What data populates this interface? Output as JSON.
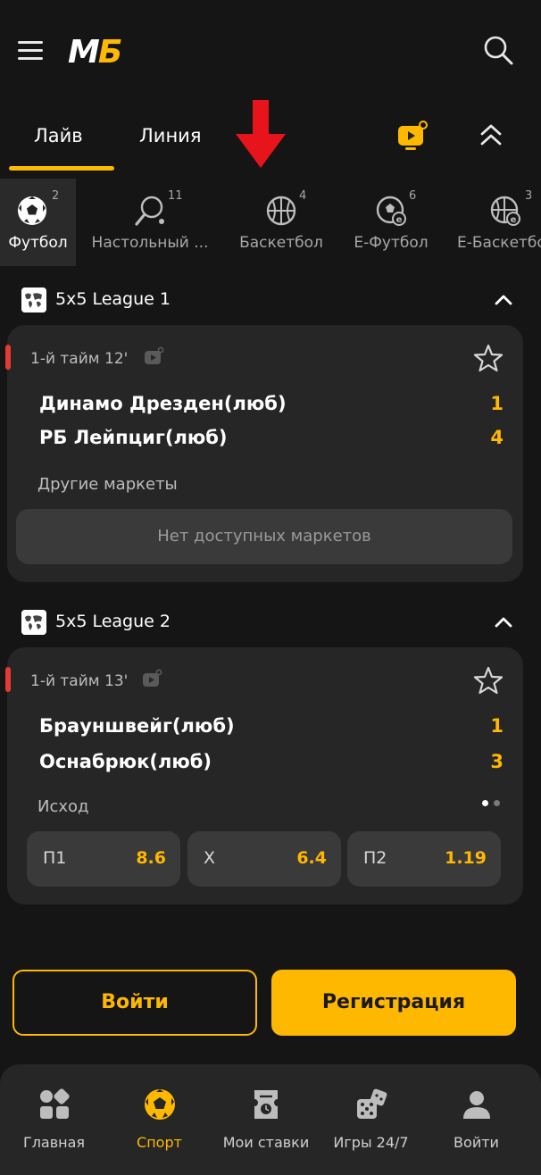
{
  "header": {
    "logo_m": "M",
    "logo_b": "Б"
  },
  "tabs": {
    "live": "Лайв",
    "line": "Линия"
  },
  "sports": [
    {
      "label": "Футбол",
      "count": "2",
      "icon": "soccer-ball-icon"
    },
    {
      "label": "Настольный ...",
      "count": "11",
      "icon": "table-tennis-icon"
    },
    {
      "label": "Баскетбол",
      "count": "4",
      "icon": "basketball-icon"
    },
    {
      "label": "E-Футбол",
      "count": "6",
      "icon": "esoccer-icon"
    },
    {
      "label": "E-Баскетбол",
      "count": "3",
      "icon": "ebasketball-icon"
    }
  ],
  "leagues": [
    {
      "name": "5x5 League 1",
      "match": {
        "time": "1-й тайм 12'",
        "team1": "Динамо Дрезден(люб)",
        "score1": "1",
        "team2": "РБ Лейпциг(люб)",
        "score2": "4",
        "markets_label": "Другие маркеты",
        "no_markets": "Нет доступных маркетов"
      }
    },
    {
      "name": "5x5 League 2",
      "match": {
        "time": "1-й тайм 13'",
        "team1": "Брауншвейг(люб)",
        "score1": "1",
        "team2": "Оснабрюк(люб)",
        "score2": "3",
        "markets_label": "Исход",
        "odds": [
          {
            "label": "П1",
            "value": "8.6"
          },
          {
            "label": "X",
            "value": "6.4"
          },
          {
            "label": "П2",
            "value": "1.19"
          }
        ]
      }
    }
  ],
  "auth": {
    "login": "Войти",
    "register": "Регистрация"
  },
  "nav": [
    {
      "label": "Главная",
      "icon": "home-grid-icon"
    },
    {
      "label": "Спорт",
      "icon": "soccer-ball-icon"
    },
    {
      "label": "Мои ставки",
      "icon": "ticket-icon"
    },
    {
      "label": "Игры 24/7",
      "icon": "dice-icon"
    },
    {
      "label": "Войти",
      "icon": "user-icon"
    }
  ],
  "colors": {
    "accent": "#ffb800",
    "background": "#151515",
    "card": "#262626",
    "live": "#e53935",
    "annotation_arrow": "#e8141b"
  }
}
